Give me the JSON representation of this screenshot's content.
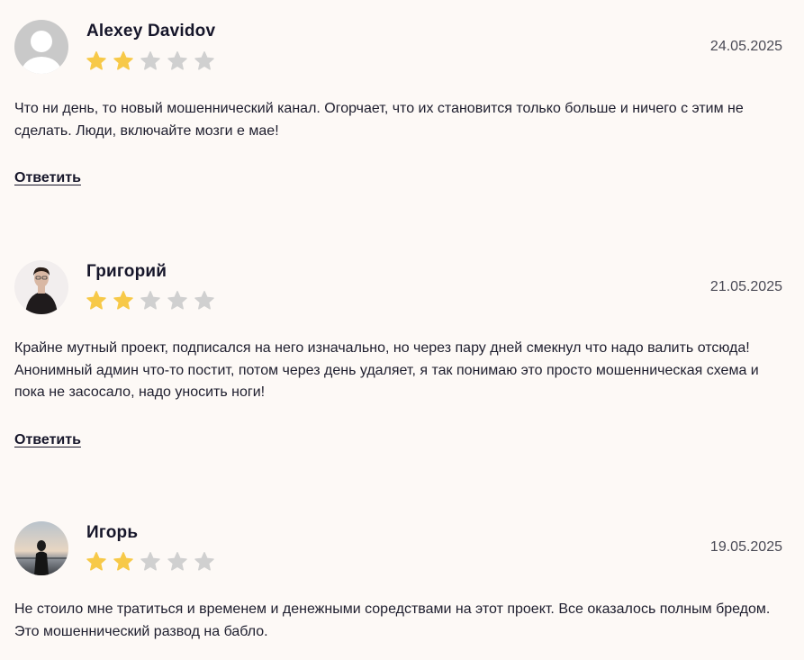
{
  "colors": {
    "background": "#fdf9f6",
    "star_filled": "#f7c948",
    "star_empty": "#d0d0d0"
  },
  "reviews": [
    {
      "author": "Alexey Davidov",
      "date": "24.05.2025",
      "rating": 2,
      "max_rating": 5,
      "avatar": "default-user-avatar",
      "text": "Что ни день, то новый мошеннический канал. Огорчает, что их становится только больше и ничего с этим не сделать. Люди, включайте мозги е мае!",
      "reply_label": "Ответить"
    },
    {
      "author": "Григорий",
      "date": "21.05.2025",
      "rating": 2,
      "max_rating": 5,
      "avatar": "photo-man-dark-shirt",
      "text": "Крайне мутный проект, подписался на него изначально, но через пару дней смекнул что надо валить отсюда! Анонимный админ что-то постит, потом через день удаляет, я так понимаю это просто мошенническая схема и пока не засосало, надо уносить ноги!",
      "reply_label": "Ответить"
    },
    {
      "author": "Игорь",
      "date": "19.05.2025",
      "rating": 2,
      "max_rating": 5,
      "avatar": "photo-man-seaside-sunset",
      "text": "Не стоило мне тратиться и временем и денежными соредствами на этот проект. Все оказалось полным бредом. Это мошеннический развод на бабло.",
      "reply_label": null
    }
  ]
}
